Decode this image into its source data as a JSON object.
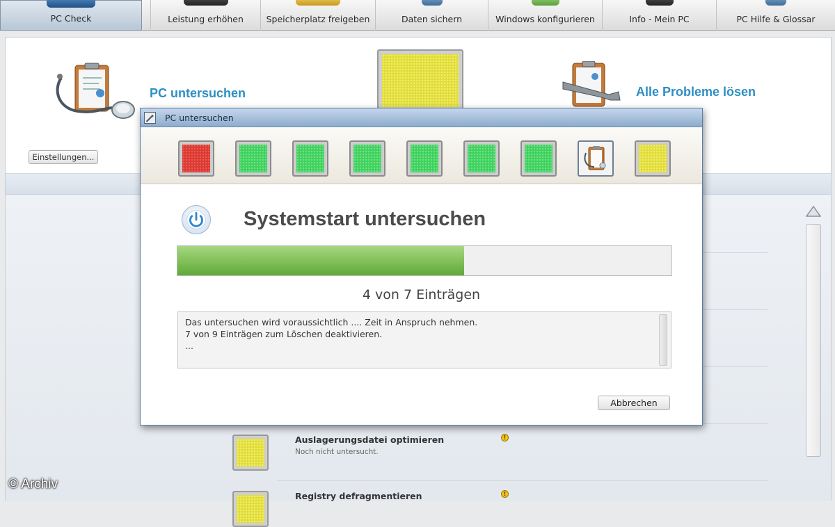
{
  "nav": {
    "items": [
      {
        "label": "PC Check",
        "icon": "pc-check-icon"
      },
      {
        "label": "Leistung erhöhen",
        "icon": "speedometer-icon"
      },
      {
        "label": "Speicherplatz freigeben",
        "icon": "disk-icon"
      },
      {
        "label": "Daten sichern",
        "icon": "backup-icon"
      },
      {
        "label": "Windows konfigurieren",
        "icon": "windows-icon"
      },
      {
        "label": "Info - Mein PC",
        "icon": "computer-icon"
      },
      {
        "label": "PC Hilfe & Glossar",
        "icon": "help-icon"
      }
    ],
    "active_index": 0
  },
  "hero": {
    "scan_title": "PC untersuchen",
    "fix_title": "Alle Probleme lösen",
    "settings_label": "Einstellungen...",
    "status_color": "#e0dc3a"
  },
  "list": {
    "rows": [
      {
        "title": "Auslagerungsdatei optimieren",
        "subtitle": "Noch nicht untersucht.",
        "warning": "!"
      },
      {
        "title": "Registry defragmentieren",
        "subtitle": "",
        "warning": "!"
      }
    ]
  },
  "dialog": {
    "title": "PC untersuchen",
    "steps": [
      "red",
      "green",
      "green",
      "green",
      "green",
      "green",
      "green",
      "active",
      "yellow"
    ],
    "heading": "Systemstart untersuchen",
    "progress": 0.58,
    "progress_label": "4 von 7 Einträgen",
    "log_lines": [
      "Das untersuchen wird voraussichtlich .... Zeit in Anspruch nehmen.",
      "7 von 9 Einträgen zum Löschen deaktivieren.",
      "..."
    ],
    "cancel_label": "Abbrechen"
  },
  "watermark": "© Archiv",
  "colors": {
    "accent": "#2e8fc4",
    "progress_green": "#6db143",
    "status_red": "#d83a33",
    "status_green": "#3fcf5d",
    "status_yellow": "#e0dc3a"
  }
}
